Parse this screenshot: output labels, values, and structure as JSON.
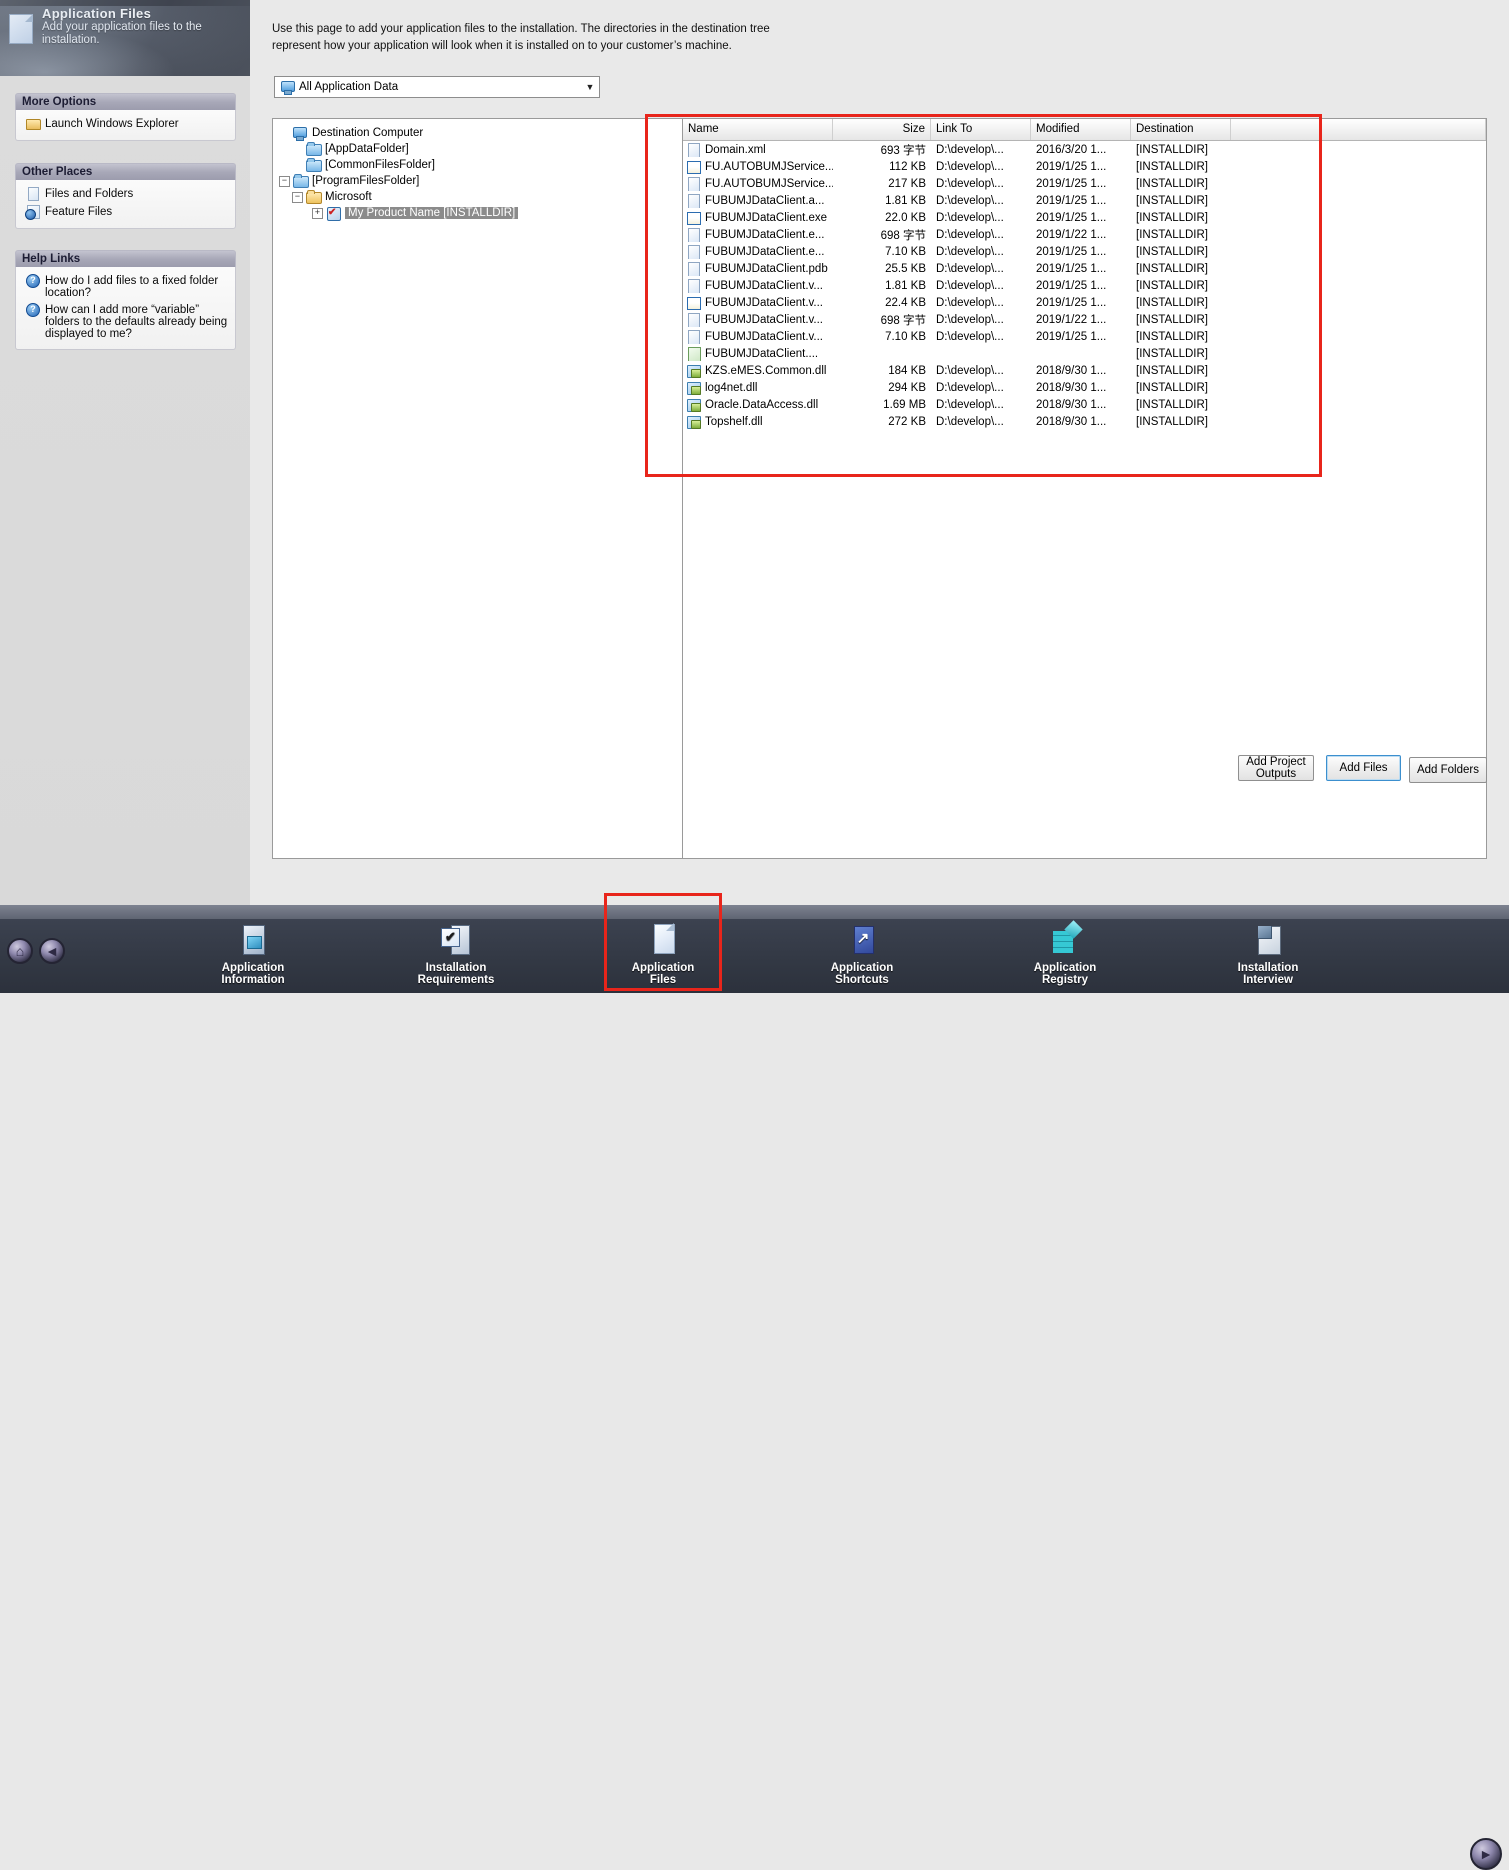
{
  "header": {
    "icon": "page-document-icon",
    "title": "Application Files",
    "subtitle": "Add your application files to the installation."
  },
  "sidebar": {
    "panels": [
      {
        "title": "More Options",
        "items": [
          {
            "icon": "folder-open-icon",
            "label": "Launch Windows Explorer"
          }
        ]
      },
      {
        "title": "Other Places",
        "items": [
          {
            "icon": "document-icon",
            "label": "Files and Folders"
          },
          {
            "icon": "feature-icon",
            "label": "Feature Files"
          }
        ]
      },
      {
        "title": "Help Links",
        "items": [
          {
            "icon": "help-icon",
            "label": "How do I add files to a fixed folder location?"
          },
          {
            "icon": "help-icon",
            "label": "How can I add more “variable” folders to the defaults already being displayed to me?"
          }
        ]
      }
    ]
  },
  "main": {
    "intro": "Use this page to add your application files to the installation. The directories in the destination tree\nrepresent how your application will look when it is installed on to your customer’s machine.",
    "filter": {
      "icon": "computer-icon",
      "value": "All Application Data",
      "arrow": "▼"
    },
    "tree": {
      "nodes": [
        {
          "label": "Destination Computer",
          "icon": "computer-icon",
          "expander": "",
          "indent": 0,
          "selected": false
        },
        {
          "label": "[AppDataFolder]",
          "icon": "folder-blue-icon",
          "expander": "",
          "indent": 1,
          "selected": false
        },
        {
          "label": "[CommonFilesFolder]",
          "icon": "folder-blue-icon",
          "expander": "",
          "indent": 1,
          "selected": false
        },
        {
          "label": "[ProgramFilesFolder]",
          "icon": "folder-blue-icon",
          "expander": "−",
          "indent": 1,
          "selected": false
        },
        {
          "label": "Microsoft",
          "icon": "folder-yellow-icon",
          "expander": "−",
          "indent": 2,
          "selected": false
        },
        {
          "label": "My Product Name [INSTALLDIR]",
          "icon": "feature-box-icon",
          "expander": "+",
          "indent": 3,
          "selected": true
        }
      ]
    },
    "filelist": {
      "columns": [
        "Name",
        "Size",
        "Link To",
        "Modified",
        "Destination",
        ""
      ],
      "rows": [
        {
          "icon": "xml-file-icon",
          "name": "Domain.xml",
          "size": "693 字节",
          "link": "D:\\develop\\...",
          "modified": "2016/3/20 1...",
          "destination": "[INSTALLDIR]"
        },
        {
          "icon": "exe-file-icon",
          "name": "FU.AUTOBUMJService...",
          "size": "112 KB",
          "link": "D:\\develop\\...",
          "modified": "2019/1/25 1...",
          "destination": "[INSTALLDIR]"
        },
        {
          "icon": "generic-file-icon",
          "name": "FU.AUTOBUMJService....",
          "size": "217 KB",
          "link": "D:\\develop\\...",
          "modified": "2019/1/25 1...",
          "destination": "[INSTALLDIR]"
        },
        {
          "icon": "generic-file-icon",
          "name": "FUBUMJDataClient.a...",
          "size": "1.81 KB",
          "link": "D:\\develop\\...",
          "modified": "2019/1/25 1...",
          "destination": "[INSTALLDIR]"
        },
        {
          "icon": "exe-file-icon",
          "name": "FUBUMJDataClient.exe",
          "size": "22.0 KB",
          "link": "D:\\develop\\...",
          "modified": "2019/1/25 1...",
          "destination": "[INSTALLDIR]"
        },
        {
          "icon": "generic-file-icon",
          "name": "FUBUMJDataClient.e...",
          "size": "698 字节",
          "link": "D:\\develop\\...",
          "modified": "2019/1/22 1...",
          "destination": "[INSTALLDIR]"
        },
        {
          "icon": "generic-file-icon",
          "name": "FUBUMJDataClient.e...",
          "size": "7.10 KB",
          "link": "D:\\develop\\...",
          "modified": "2019/1/25 1...",
          "destination": "[INSTALLDIR]"
        },
        {
          "icon": "generic-file-icon",
          "name": "FUBUMJDataClient.pdb",
          "size": "25.5 KB",
          "link": "D:\\develop\\...",
          "modified": "2019/1/25 1...",
          "destination": "[INSTALLDIR]"
        },
        {
          "icon": "generic-file-icon",
          "name": "FUBUMJDataClient.v...",
          "size": "1.81 KB",
          "link": "D:\\develop\\...",
          "modified": "2019/1/25 1...",
          "destination": "[INSTALLDIR]"
        },
        {
          "icon": "exe-file-icon",
          "name": "FUBUMJDataClient.v...",
          "size": "22.4 KB",
          "link": "D:\\develop\\...",
          "modified": "2019/1/25 1...",
          "destination": "[INSTALLDIR]"
        },
        {
          "icon": "generic-file-icon",
          "name": "FUBUMJDataClient.v...",
          "size": "698 字节",
          "link": "D:\\develop\\...",
          "modified": "2019/1/22 1...",
          "destination": "[INSTALLDIR]"
        },
        {
          "icon": "generic-file-icon",
          "name": "FUBUMJDataClient.v...",
          "size": "7.10 KB",
          "link": "D:\\develop\\...",
          "modified": "2019/1/25 1...",
          "destination": "[INSTALLDIR]"
        },
        {
          "icon": "config-file-icon",
          "name": "FUBUMJDataClient....",
          "size": "",
          "link": "",
          "modified": "",
          "destination": "[INSTALLDIR]"
        },
        {
          "icon": "dll-file-icon",
          "name": "KZS.eMES.Common.dll",
          "size": "184 KB",
          "link": "D:\\develop\\...",
          "modified": "2018/9/30 1...",
          "destination": "[INSTALLDIR]"
        },
        {
          "icon": "dll-file-icon",
          "name": "log4net.dll",
          "size": "294 KB",
          "link": "D:\\develop\\...",
          "modified": "2018/9/30 1...",
          "destination": "[INSTALLDIR]"
        },
        {
          "icon": "dll-file-icon",
          "name": "Oracle.DataAccess.dll",
          "size": "1.69 MB",
          "link": "D:\\develop\\...",
          "modified": "2018/9/30 1...",
          "destination": "[INSTALLDIR]"
        },
        {
          "icon": "dll-file-icon",
          "name": "Topshelf.dll",
          "size": "272 KB",
          "link": "D:\\develop\\...",
          "modified": "2018/9/30 1...",
          "destination": "[INSTALLDIR]"
        }
      ]
    },
    "buttons": {
      "add_project_outputs": "Add Project\nOutputs",
      "add_files": "Add Files",
      "add_folders": "Add Folders"
    }
  },
  "navbar": {
    "home_glyph": "⌂",
    "back_glyph": "◄",
    "next_glyph": "►",
    "items": [
      {
        "icon": "application-information-icon",
        "label": "Application\nInformation",
        "selected": false
      },
      {
        "icon": "installation-requirements-icon",
        "label": "Installation\nRequirements",
        "selected": false
      },
      {
        "icon": "application-files-icon",
        "label": "Application\nFiles",
        "selected": true
      },
      {
        "icon": "application-shortcuts-icon",
        "label": "Application\nShortcuts",
        "selected": false
      },
      {
        "icon": "application-registry-icon",
        "label": "Application\nRegistry",
        "selected": false
      },
      {
        "icon": "installation-interview-icon",
        "label": "Installation\nInterview",
        "selected": false
      }
    ]
  },
  "annotations": {
    "highlight_color": "#e8251b",
    "boxes": [
      "file-list-highlight",
      "application-files-nav-highlight"
    ]
  }
}
